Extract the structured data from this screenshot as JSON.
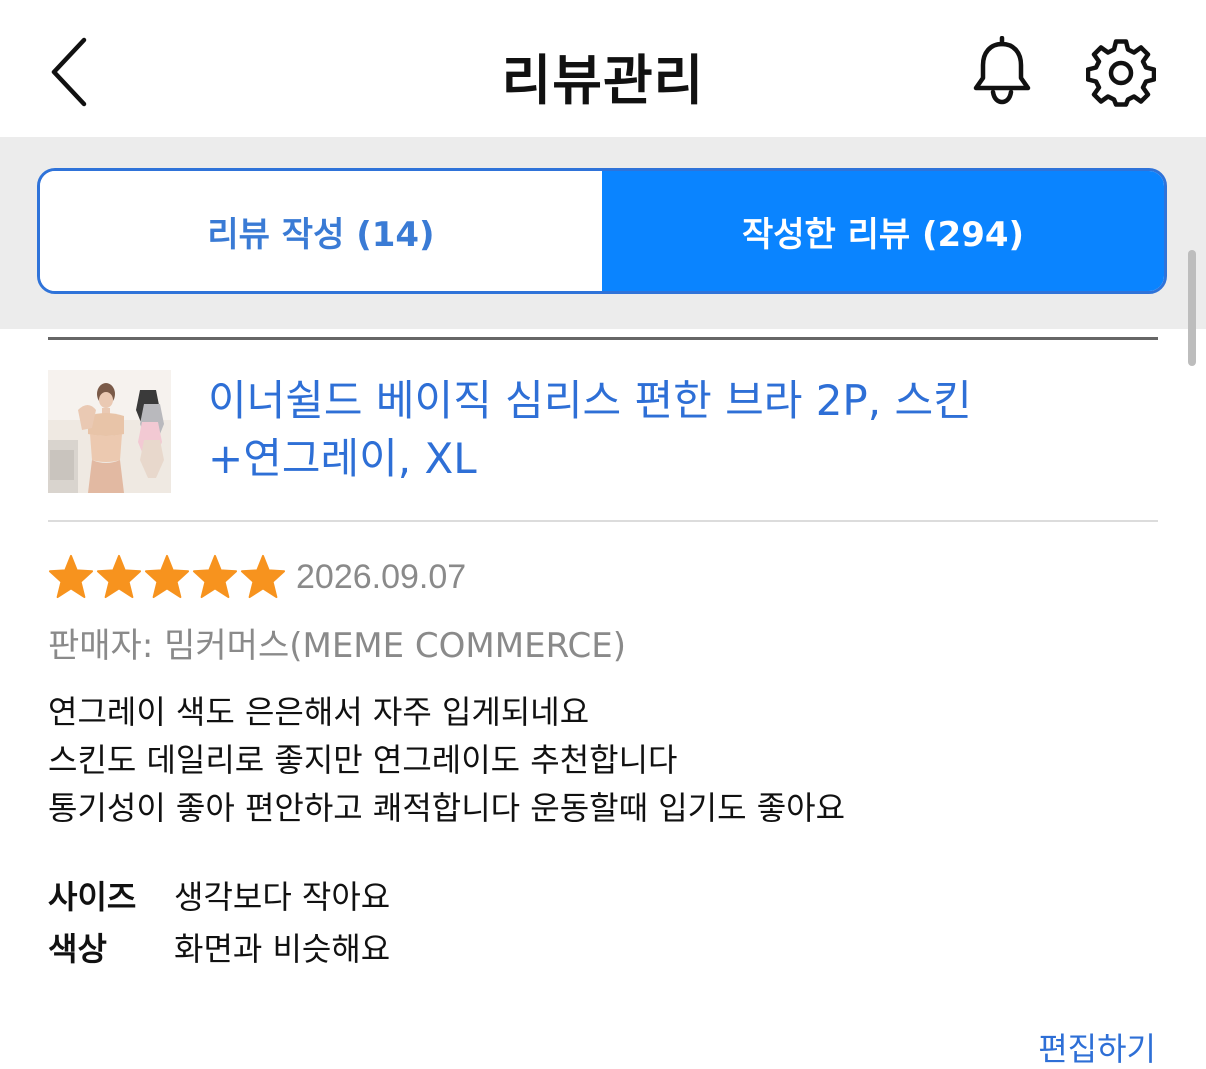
{
  "header": {
    "title": "리뷰관리",
    "back_icon": "chevron-left-icon",
    "bell_icon": "bell-icon",
    "settings_icon": "gear-icon"
  },
  "tabs": [
    {
      "label": "리뷰 작성 (14)",
      "active": false
    },
    {
      "label": "작성한 리뷰 (294)",
      "active": true
    }
  ],
  "colors": {
    "accent": "#0a84ff",
    "link": "#2e6fd6",
    "star": "#f7931e",
    "muted": "#8a8a8a"
  },
  "review": {
    "product_line1": "이너쉴드 베이직 심리스 편한 브라 2P, 스킨",
    "product_line2": "+연그레이, XL",
    "rating": 5,
    "rating_max": 5,
    "date": "2026.09.07",
    "seller": "판매자: 밈커머스(MEME COMMERCE)",
    "text_lines": [
      "연그레이 색도 은은해서 자주 입게되네요",
      "스킨도 데일리로 좋지만 연그레이도 추천합니다",
      "통기성이 좋아 편안하고 쾌적합니다 운동할때 입기도 좋아요"
    ],
    "attributes": [
      {
        "key": "사이즈",
        "value": "생각보다 작아요"
      },
      {
        "key": "색상",
        "value": "화면과 비슷해요"
      }
    ],
    "edit_label": "편집하기"
  }
}
